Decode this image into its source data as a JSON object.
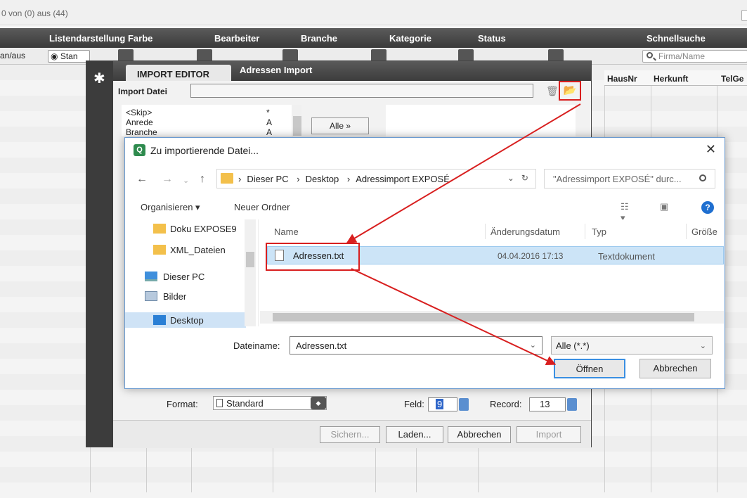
{
  "app": {
    "record_count": "0 von (0) aus (44)",
    "header_items": [
      "Listendarstellung Farbe",
      "Bearbeiter",
      "Branche",
      "Kategorie",
      "Status",
      "Schnellsuche"
    ],
    "filter_label_left": "an/aus",
    "filter_standard": "Stan",
    "search_placeholder": "Firma/Name",
    "columns": [
      "HausNr",
      "Herkunft",
      "TelGe"
    ]
  },
  "editor": {
    "tab": "IMPORT EDITOR",
    "title": "Adressen Import",
    "file_label": "Import Datei",
    "fields": [
      {
        "name": "<Skip>",
        "code": "*"
      },
      {
        "name": "Anrede",
        "code": "A"
      },
      {
        "name": "Branche",
        "code": "A"
      }
    ],
    "all_button": "Alle »",
    "format_label": "Format:",
    "format_value": "Standard",
    "feld_label": "Feld:",
    "feld_value": "9",
    "record_label": "Record:",
    "record_value": "13",
    "buttons": {
      "save": "Sichern...",
      "load": "Laden...",
      "cancel": "Abbrechen",
      "import": "Import"
    }
  },
  "dialog": {
    "title": "Zu importierende Datei...",
    "breadcrumb": [
      "Dieser PC",
      "Desktop",
      "Adressimport EXPOSÉ"
    ],
    "search_placeholder": "\"Adressimport EXPOSÉ\" durc...",
    "organize": "Organisieren ▾",
    "new_folder": "Neuer Ordner",
    "help": "?",
    "tree": [
      {
        "label": "Doku EXPOSE9",
        "icon": "folder-icon"
      },
      {
        "label": "XML_Dateien",
        "icon": "folder-icon"
      },
      {
        "label": "Dieser PC",
        "icon": "computer-icon"
      },
      {
        "label": "Bilder",
        "icon": "pictures-icon"
      },
      {
        "label": "Desktop",
        "icon": "desktop-icon"
      }
    ],
    "columns": [
      "Name",
      "Änderungsdatum",
      "Typ",
      "Größe"
    ],
    "file": {
      "name": "Adressen.txt",
      "date": "04.04.2016 17:13",
      "type": "Textdokument"
    },
    "filename_label": "Dateiname:",
    "filename_value": "Adressen.txt",
    "filetype": "Alle (*.*)",
    "open_button": "Öffnen",
    "cancel_button": "Abbrechen"
  },
  "colors": {
    "annotation": "#d81f1f",
    "selection": "#cce4f7",
    "header_dark": "#3a3a3a"
  }
}
